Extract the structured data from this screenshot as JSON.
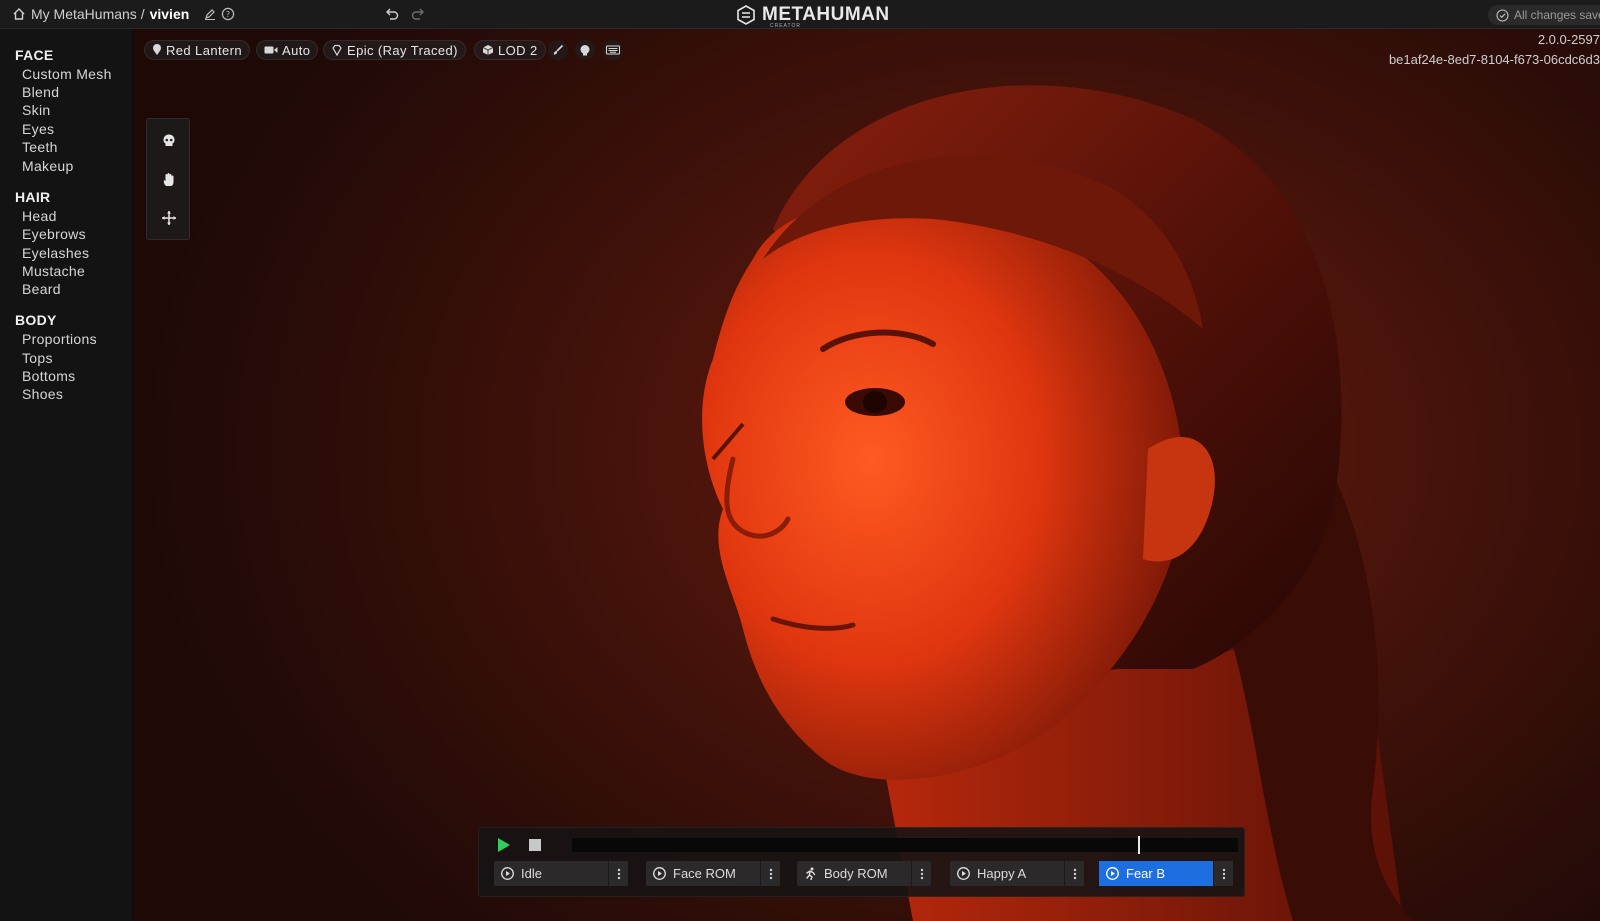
{
  "header": {
    "breadcrumb_root": "My MetaHumans /",
    "character_name": "vivien",
    "logo_text": "METAHUMAN",
    "logo_sub": "CREATOR",
    "save_status": "All changes saved"
  },
  "sidebar": {
    "sections": [
      {
        "title": "FACE",
        "items": [
          "Custom Mesh",
          "Blend",
          "Skin",
          "Eyes",
          "Teeth",
          "Makeup"
        ]
      },
      {
        "title": "HAIR",
        "items": [
          "Head",
          "Eyebrows",
          "Eyelashes",
          "Mustache",
          "Beard"
        ]
      },
      {
        "title": "BODY",
        "items": [
          "Proportions",
          "Tops",
          "Bottoms",
          "Shoes"
        ]
      }
    ]
  },
  "viewport": {
    "lighting": "Red Lantern",
    "camera": "Auto",
    "quality": "Epic (Ray Traced)",
    "lod": "LOD 2",
    "version": "2.0.0-2597",
    "build_id": "be1af24e-8ed7-8104-f673-06cdc6d3"
  },
  "animation": {
    "progress": 0.85,
    "clips": [
      {
        "label": "Idle",
        "icon": "play-circle-icon",
        "active": false
      },
      {
        "label": "Face ROM",
        "icon": "play-circle-icon",
        "active": false
      },
      {
        "label": "Body ROM",
        "icon": "running-figure-icon",
        "active": false
      },
      {
        "label": "Happy A",
        "icon": "play-circle-icon",
        "active": false
      },
      {
        "label": "Fear B",
        "icon": "play-circle-icon",
        "active": true
      }
    ]
  },
  "colors": {
    "accent": "#1d6fe0",
    "play": "#2fcf5a",
    "background_light": "#6a1a0c"
  }
}
